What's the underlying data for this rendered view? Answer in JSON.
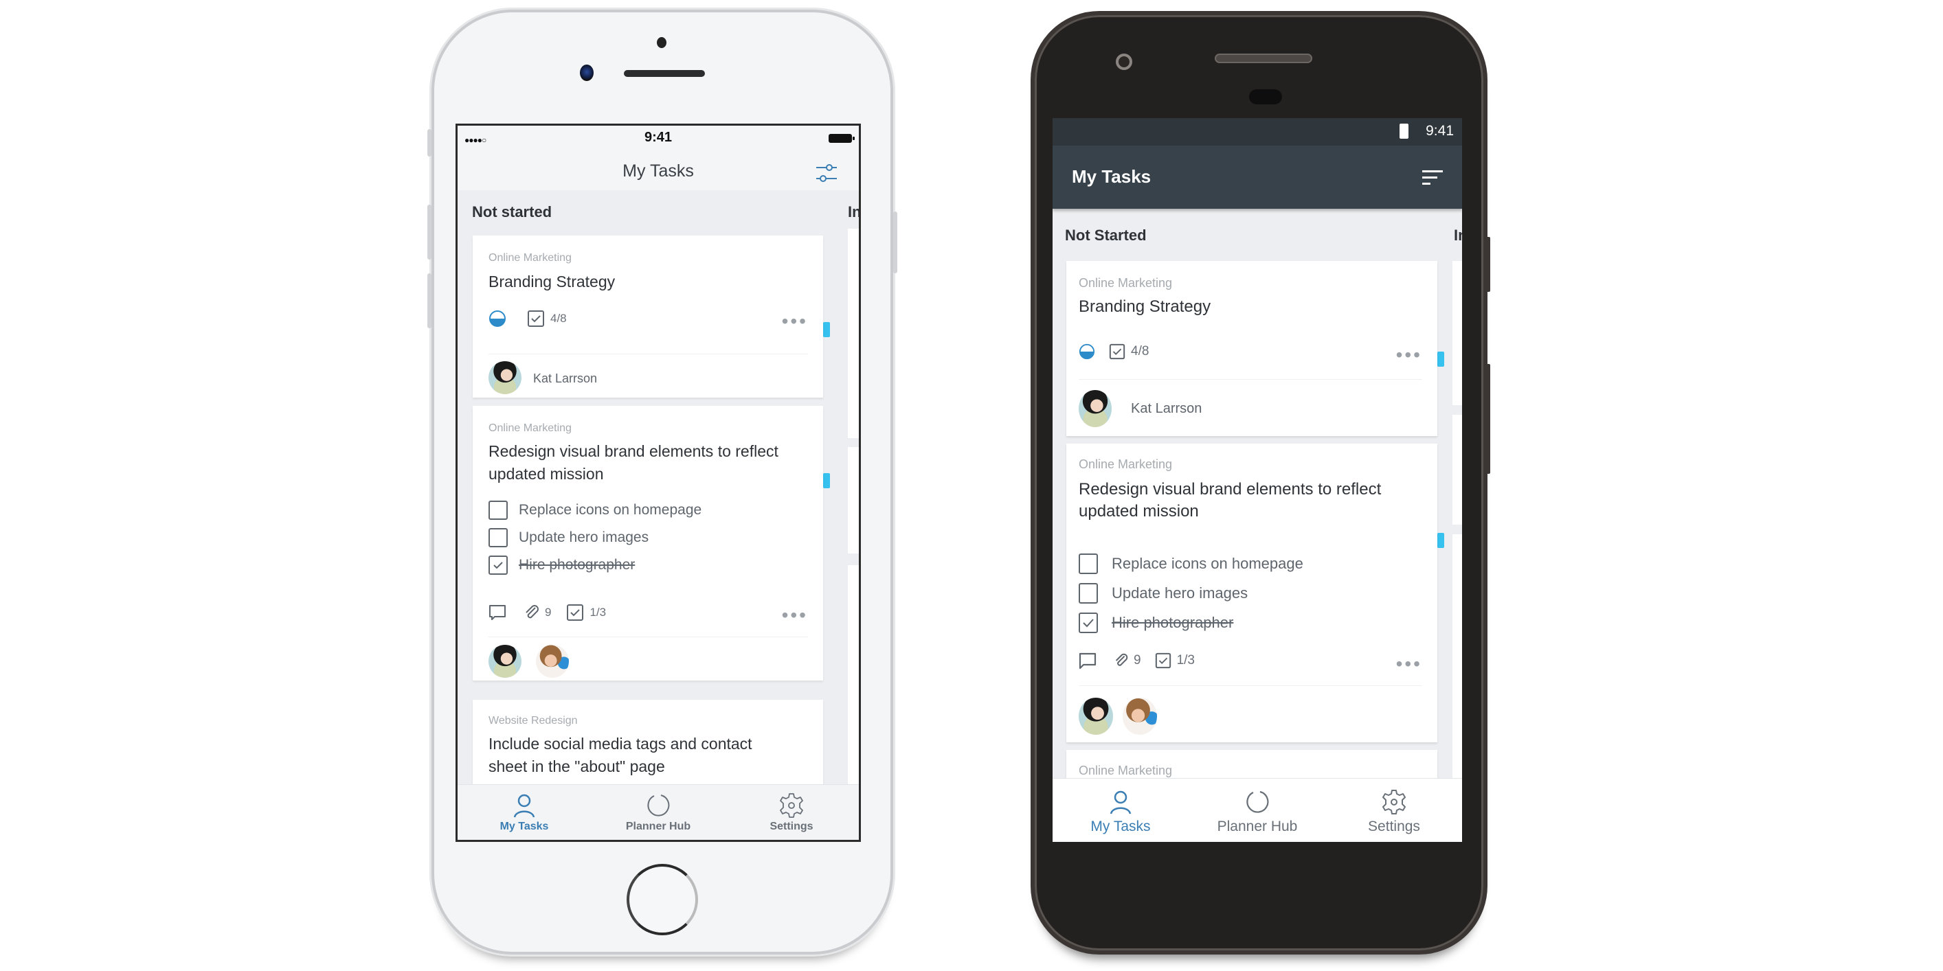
{
  "ios": {
    "status": {
      "signal": "●●●●○",
      "time": "9:41"
    },
    "nav": {
      "title": "My Tasks",
      "filter_icon": "filter-sliders-icon"
    },
    "columns": [
      {
        "title": "Not started"
      },
      {
        "title": "In"
      }
    ],
    "cards": [
      {
        "plan": "Online Marketing",
        "title": "Branding Strategy",
        "progress": "half-complete",
        "checklist_count": "4/8",
        "assignee": "Kat Larrson"
      },
      {
        "plan": "Online Marketing",
        "title_line1": "Redesign visual brand elements to reflect",
        "title_line2": "updated mission",
        "checklist": [
          {
            "label": "Replace icons on homepage",
            "checked": false
          },
          {
            "label": "Update hero images",
            "checked": false
          },
          {
            "label": "Hire photographer",
            "checked": true
          }
        ],
        "attachments": "9",
        "checklist_count": "1/3"
      },
      {
        "plan": "Website Redesign",
        "title_line1": "Include social media tags and contact",
        "title_line2": "sheet in the \"about\" page"
      }
    ],
    "tabs": [
      {
        "label": "My Tasks",
        "icon": "person-icon",
        "active": true
      },
      {
        "label": "Planner Hub",
        "icon": "hub-circle-icon",
        "active": false
      },
      {
        "label": "Settings",
        "icon": "gear-icon",
        "active": false
      }
    ]
  },
  "android": {
    "status": {
      "time": "9:41"
    },
    "appbar": {
      "title": "My Tasks",
      "sort_icon": "sort-icon"
    },
    "columns": [
      {
        "title": "Not Started"
      },
      {
        "title": "In"
      }
    ],
    "cards": [
      {
        "plan": "Online Marketing",
        "title": "Branding Strategy",
        "progress": "half-complete",
        "checklist_count": "4/8",
        "assignee": "Kat Larrson"
      },
      {
        "plan": "Online Marketing",
        "title_line1": "Redesign visual brand elements to reflect",
        "title_line2": "updated mission",
        "checklist": [
          {
            "label": "Replace icons on homepage",
            "checked": false
          },
          {
            "label": "Update hero images",
            "checked": false
          },
          {
            "label": "Hire photographer",
            "checked": true
          }
        ],
        "attachments": "9",
        "checklist_count": "1/3"
      },
      {
        "plan": "Online Marketing"
      }
    ],
    "tabs": [
      {
        "label": "My Tasks",
        "icon": "person-icon",
        "active": true
      },
      {
        "label": "Planner Hub",
        "icon": "hub-circle-icon",
        "active": false
      },
      {
        "label": "Settings",
        "icon": "gear-icon",
        "active": false
      }
    ]
  },
  "colors": {
    "accent": "#3a7eb4",
    "progress": "#2e8bc9",
    "label_bar": "#36c1ef",
    "android_appbar": "#37424a",
    "android_status": "#2f373d"
  }
}
